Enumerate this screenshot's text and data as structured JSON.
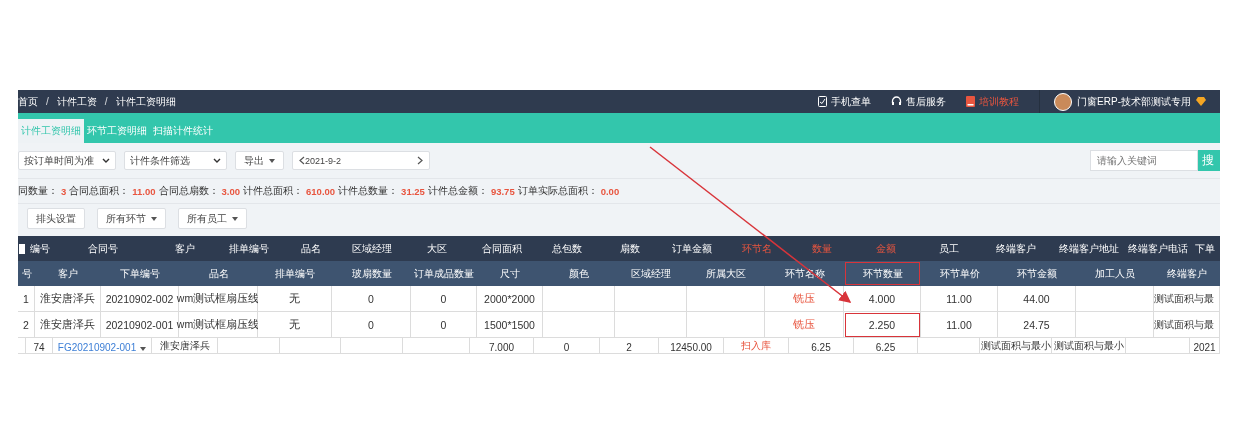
{
  "topbar": {
    "breadcrumb": [
      "首页",
      "计件工资",
      "计件工资明细"
    ],
    "breadcrumb_separator": "/",
    "links": [
      {
        "kind": "phone",
        "label": "手机查单",
        "highlighted": false
      },
      {
        "kind": "headset",
        "label": "售后服务",
        "highlighted": false
      },
      {
        "kind": "book",
        "label": "培训教程",
        "highlighted": true
      }
    ],
    "user": "门窗ERP-技术部测试专用"
  },
  "tabs": [
    {
      "label": "计件工资明细",
      "selected": true
    },
    {
      "label": "环节工资明细",
      "selected": false
    },
    {
      "label": "扫描计件统计",
      "selected": false
    }
  ],
  "toolbar": {
    "time_select": "按订单时间为准",
    "filter_select": "计件条件筛选",
    "export_button": "导出",
    "date": "2021-9-2",
    "search_placeholder": "请输入关键词",
    "search_button": "搜"
  },
  "summary": [
    {
      "label": "同数量：",
      "value": "3"
    },
    {
      "label": "合同总面积：",
      "value": "11.00"
    },
    {
      "label": "合同总扇数：",
      "value": "3.00"
    },
    {
      "label": "计件总面积：",
      "value": "610.00"
    },
    {
      "label": "计件总数量：",
      "value": "31.25"
    },
    {
      "label": "计件总金额：",
      "value": "93.75"
    },
    {
      "label": "订单实际总面积：",
      "value": "0.00"
    }
  ],
  "buttons": [
    {
      "label": "排头设置",
      "dropdown": false
    },
    {
      "label": "所有环节",
      "dropdown": true
    },
    {
      "label": "所有员工",
      "dropdown": true
    }
  ],
  "table": {
    "select_all_checked": false,
    "group_columns": [
      {
        "label": "编号",
        "accent": false
      },
      {
        "label": "合同号",
        "accent": false
      },
      {
        "label": "客户",
        "accent": false
      },
      {
        "label": "排单编号",
        "accent": false
      },
      {
        "label": "品名",
        "accent": false
      },
      {
        "label": "区域经理",
        "accent": false
      },
      {
        "label": "大区",
        "accent": false
      },
      {
        "label": "合同面积",
        "accent": false
      },
      {
        "label": "总包数",
        "accent": false
      },
      {
        "label": "扇数",
        "accent": false
      },
      {
        "label": "订单金额",
        "accent": false
      },
      {
        "label": "环节名",
        "accent": true
      },
      {
        "label": "数量",
        "accent": true
      },
      {
        "label": "金额",
        "accent": true
      },
      {
        "label": "员工",
        "accent": false
      },
      {
        "label": "终端客户",
        "accent": false
      },
      {
        "label": "终端客户地址",
        "accent": false
      },
      {
        "label": "终端客户电话",
        "accent": false
      },
      {
        "label": "下单",
        "accent": false
      }
    ],
    "columns": [
      {
        "label": "号",
        "highlighted": false
      },
      {
        "label": "客户",
        "highlighted": false
      },
      {
        "label": "下单编号",
        "highlighted": false
      },
      {
        "label": "品名",
        "highlighted": false
      },
      {
        "label": "排单编号",
        "highlighted": false
      },
      {
        "label": "玻扇数量",
        "highlighted": false
      },
      {
        "label": "订单成品数量",
        "highlighted": false
      },
      {
        "label": "尺寸",
        "highlighted": false
      },
      {
        "label": "颜色",
        "highlighted": false
      },
      {
        "label": "区域经理",
        "highlighted": false
      },
      {
        "label": "所属大区",
        "highlighted": false
      },
      {
        "label": "环节名称",
        "highlighted": false,
        "kind": "process"
      },
      {
        "label": "环节数量",
        "highlighted": true
      },
      {
        "label": "环节单价",
        "highlighted": false
      },
      {
        "label": "环节金额",
        "highlighted": false
      },
      {
        "label": "加工人员",
        "highlighted": false
      },
      {
        "label": "终端客户",
        "highlighted": false
      }
    ],
    "rows": [
      {
        "cells": [
          "1",
          "淮安唐泽兵",
          "20210902-002",
          "wm测试框扇压线",
          "无",
          "0",
          "0",
          "2000*2000",
          null,
          null,
          null,
          "铣压",
          {
            "text": "4.000",
            "highlighted": false
          },
          "11.00",
          "44.00",
          null,
          "测试面积与最"
        ]
      },
      {
        "cells": [
          "2",
          "淮安唐泽兵",
          "20210902-001",
          "wm测试框扇压线",
          "无",
          "0",
          "0",
          "1500*1500",
          null,
          null,
          null,
          "铣压",
          {
            "text": "2.250",
            "highlighted": true
          },
          "11.00",
          "24.75",
          null,
          "测试面积与最"
        ]
      }
    ],
    "partial_row": [
      {
        "kind": "empty"
      },
      {
        "text": "74",
        "kind": "plain"
      },
      {
        "text": "FG20210902-001",
        "kind": "link"
      },
      {
        "text": "淮安唐泽兵",
        "kind": "plain"
      },
      {
        "kind": "empty"
      },
      {
        "kind": "empty"
      },
      {
        "kind": "empty"
      },
      {
        "kind": "empty"
      },
      {
        "text": "7.000",
        "kind": "plain"
      },
      {
        "text": "0",
        "kind": "plain"
      },
      {
        "text": "2",
        "kind": "plain"
      },
      {
        "text": "12450.00",
        "kind": "plain"
      },
      {
        "text": "扫入库",
        "kind": "process"
      },
      {
        "text": "6.25",
        "kind": "plain"
      },
      {
        "text": "6.25",
        "kind": "plain"
      },
      {
        "kind": "empty"
      },
      {
        "text": "测试面积与最小",
        "kind": "plain"
      },
      {
        "text": "测试面积与最小",
        "kind": "plain"
      },
      {
        "kind": "empty"
      },
      {
        "text": "2021",
        "kind": "plain"
      }
    ]
  },
  "arrow_annotation": true
}
